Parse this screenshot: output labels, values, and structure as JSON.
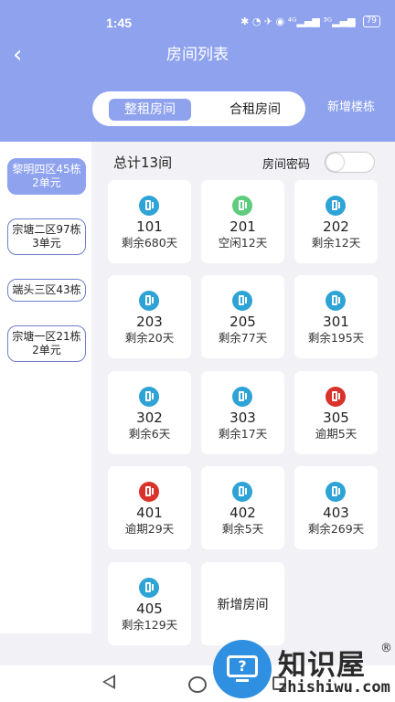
{
  "status": {
    "time": "1:45",
    "icons": "✱ ◔ ✈ ◉ ⁴ᴳ▂▄▆ ³ᴳ▂▄▆",
    "battery": "79"
  },
  "header": {
    "title": "房间列表",
    "back_icon": "chevron-left-icon"
  },
  "tabs": [
    {
      "label": "整租房间",
      "active": true
    },
    {
      "label": "合租房间",
      "active": false
    }
  ],
  "actions": {
    "add_building": "新增楼栋"
  },
  "sidebar": {
    "items": [
      {
        "label": "黎明四区45栋2单元",
        "active": true
      },
      {
        "label": "宗塘二区97栋3单元",
        "active": false
      },
      {
        "label": "端头三区43栋",
        "active": false
      },
      {
        "label": "宗塘一区21栋2单元",
        "active": false
      }
    ]
  },
  "summary": {
    "total": "总计13间",
    "password_label": "房间密码",
    "password_toggle_on": false
  },
  "colors": {
    "rented": "#2ea3d6",
    "vacant": "#5fcb7d",
    "overdue": "#d8322a",
    "accent": "#8ea2ee"
  },
  "rooms": [
    {
      "number": "101",
      "status": "剩余680天",
      "state": "rented"
    },
    {
      "number": "201",
      "status": "空闲12天",
      "state": "vacant"
    },
    {
      "number": "202",
      "status": "剩余12天",
      "state": "rented"
    },
    {
      "number": "203",
      "status": "剩余20天",
      "state": "rented"
    },
    {
      "number": "205",
      "status": "剩余77天",
      "state": "rented"
    },
    {
      "number": "301",
      "status": "剩余195天",
      "state": "rented"
    },
    {
      "number": "302",
      "status": "剩余6天",
      "state": "rented"
    },
    {
      "number": "303",
      "status": "剩余17天",
      "state": "rented"
    },
    {
      "number": "305",
      "status": "逾期5天",
      "state": "overdue"
    },
    {
      "number": "401",
      "status": "逾期29天",
      "state": "overdue"
    },
    {
      "number": "402",
      "status": "剩余5天",
      "state": "rented"
    },
    {
      "number": "403",
      "status": "剩余269天",
      "state": "rented"
    },
    {
      "number": "405",
      "status": "剩余129天",
      "state": "rented"
    }
  ],
  "add_room": {
    "label": "新增房间"
  },
  "watermark": {
    "name": "知识屋",
    "reg": "®",
    "url": "zhishiwu.com",
    "icon": "?"
  }
}
